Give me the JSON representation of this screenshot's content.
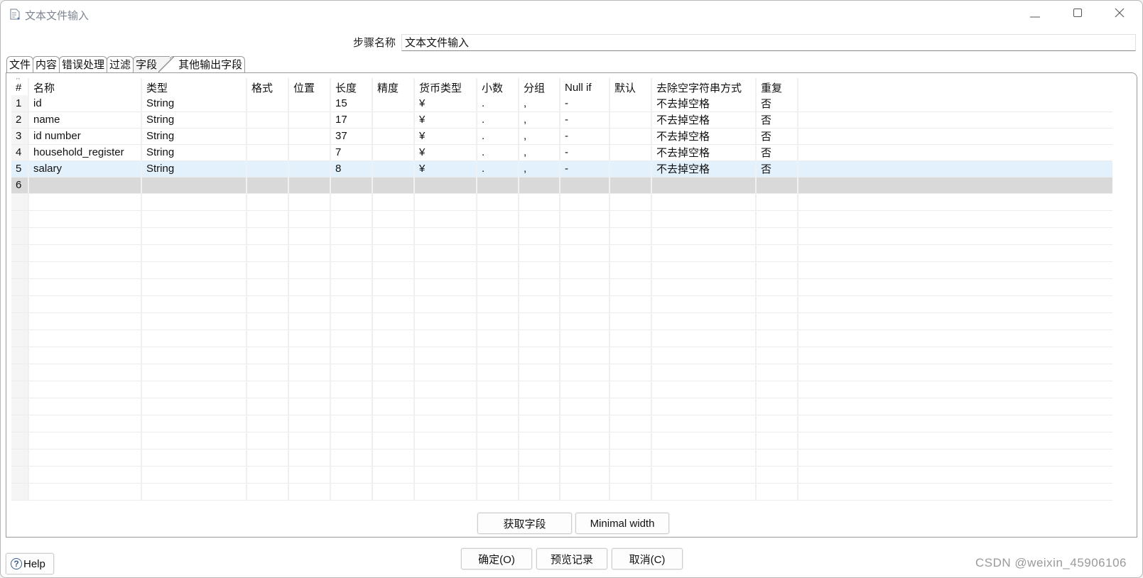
{
  "window": {
    "title": "文本文件输入",
    "icon": "text-file-icon",
    "controls": {
      "minimize": "minimize-icon",
      "maximize": "maximize-icon",
      "close": "close-icon"
    }
  },
  "step": {
    "label": "步骤名称",
    "value": "文本文件输入"
  },
  "tabs": [
    {
      "label": "文件",
      "active": false
    },
    {
      "label": "内容",
      "active": false
    },
    {
      "label": "错误处理",
      "active": false
    },
    {
      "label": "过滤",
      "active": false
    },
    {
      "label": "字段",
      "active": true
    },
    {
      "label": "其他输出字段",
      "active": false
    }
  ],
  "grid": {
    "columns": [
      "#",
      "名称",
      "类型",
      "格式",
      "位置",
      "长度",
      "精度",
      "货币类型",
      "小数",
      "分组",
      "Null if",
      "默认",
      "去除空字符串方式",
      "重复"
    ],
    "rows": [
      [
        "1",
        "id",
        "String",
        "",
        "",
        "15",
        "",
        "¥",
        ".",
        ",",
        "-",
        "",
        "不去掉空格",
        "否"
      ],
      [
        "2",
        "name",
        "String",
        "",
        "",
        "17",
        "",
        "¥",
        ".",
        ",",
        "-",
        "",
        "不去掉空格",
        "否"
      ],
      [
        "3",
        "id number",
        "String",
        "",
        "",
        "37",
        "",
        "¥",
        ".",
        ",",
        "-",
        "",
        "不去掉空格",
        "否"
      ],
      [
        "4",
        "household_register",
        "String",
        "",
        "",
        "7",
        "",
        "¥",
        ".",
        ",",
        "-",
        "",
        "不去掉空格",
        "否"
      ],
      [
        "5",
        "salary",
        "String",
        "",
        "",
        "8",
        "",
        "¥",
        ".",
        ",",
        "-",
        "",
        "不去掉空格",
        "否"
      ],
      [
        "6",
        "",
        "",
        "",
        "",
        "",
        "",
        "",
        "",
        "",
        "",
        "",
        "",
        ""
      ]
    ],
    "selected_row": 5,
    "editing_row": 6,
    "empty_rows": 18
  },
  "buttons": {
    "get_fields": "获取字段",
    "minimal_width": "Minimal width",
    "ok": "确定(O)",
    "preview": "预览记录",
    "cancel": "取消(C)",
    "help": "Help"
  },
  "watermark": "CSDN @weixin_45906106"
}
